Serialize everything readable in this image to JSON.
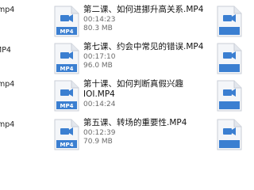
{
  "left_column": [
    {
      "name": ".mp4"
    },
    {
      "name": "MP4"
    },
    {
      "name": ".mp4"
    },
    {
      "name": ".mp4"
    }
  ],
  "files": [
    {
      "name": "第二课、如何进挪升高关系.MP4",
      "name2": "",
      "duration": "00:14:23",
      "size": "80.3 MB",
      "ext": "MP4"
    },
    {
      "name": "第七课、约会中常见的错误.MP4",
      "name2": "",
      "duration": "00:17:10",
      "size": "96.0 MB",
      "ext": "MP4"
    },
    {
      "name": "第十课、如何判断真假兴趣",
      "name2": "IOI.MP4",
      "duration": "00:14:24",
      "size": "",
      "ext": "MP4"
    },
    {
      "name": "第五课、转场的重要性.MP4",
      "name2": "",
      "duration": "00:12:39",
      "size": "70.9 MB",
      "ext": "MP4"
    }
  ],
  "icons": {
    "file": "video-file-icon",
    "color_page": "#f4f6f9",
    "color_border": "#c9ced6",
    "color_label": "#3b7fd1"
  }
}
